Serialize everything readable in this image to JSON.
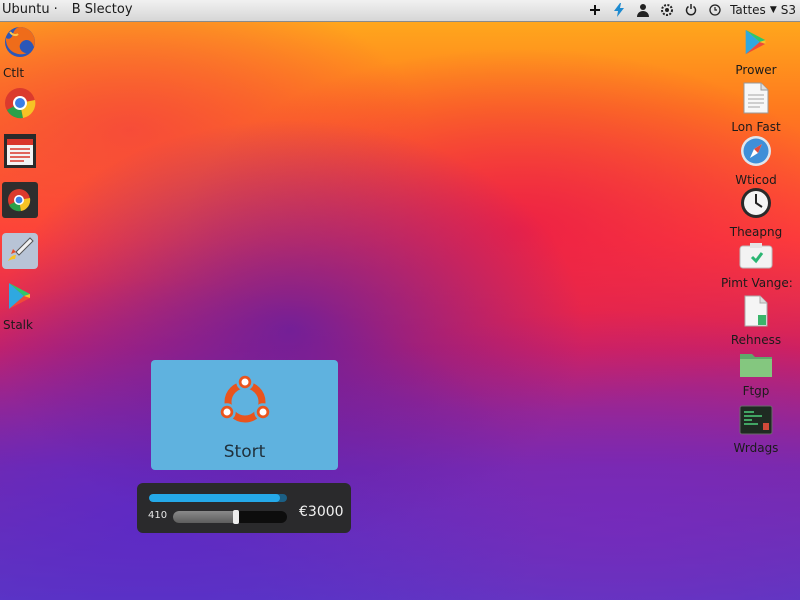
{
  "top_panel": {
    "app_name": "Ubuntu",
    "separator": "·",
    "window_title": "B Slectoy",
    "tray_user": "Tattes",
    "tray_arrow": "▼",
    "tray_count": "S3",
    "tray_icons": [
      "plus-icon",
      "bolt-icon",
      "user-icon",
      "gear-icon",
      "power-icon",
      "clock-icon"
    ]
  },
  "desktop_left": [
    {
      "label": "Ctlt",
      "icon": "firefox-icon"
    },
    {
      "label": "",
      "icon": "chrome-icon"
    },
    {
      "label": "",
      "icon": "calendar-app-icon"
    },
    {
      "label": "",
      "icon": "chrome-dark-icon"
    },
    {
      "label": "",
      "icon": "rocket-app-icon"
    },
    {
      "label": "Stalk",
      "icon": "play-store-icon"
    }
  ],
  "desktop_right": [
    {
      "label": "Prower",
      "icon": "play-store-icon"
    },
    {
      "label": "Lon Fast",
      "icon": "document-icon"
    },
    {
      "label": "Wticod",
      "icon": "compass-icon"
    },
    {
      "label": "Theapng",
      "icon": "clock-icon"
    },
    {
      "label": "Pimt Vange:",
      "icon": "camera-icon"
    },
    {
      "label": "Rehness",
      "icon": "file-icon"
    },
    {
      "label": "Ftgp",
      "icon": "folder-icon"
    },
    {
      "label": "Wrdags",
      "icon": "terminal-icon"
    }
  ],
  "start_tile": {
    "label": "Stort",
    "icon": "ubuntu-logo-icon"
  },
  "progress_panel": {
    "progress_fraction": 0.95,
    "slider_label": "410",
    "slider_fraction": 0.55,
    "value_text": "€3000"
  },
  "colors": {
    "tile_bg": "#5fb2df",
    "progress_blue": "#25a9e8",
    "ubuntu_orange": "#e9541d"
  }
}
